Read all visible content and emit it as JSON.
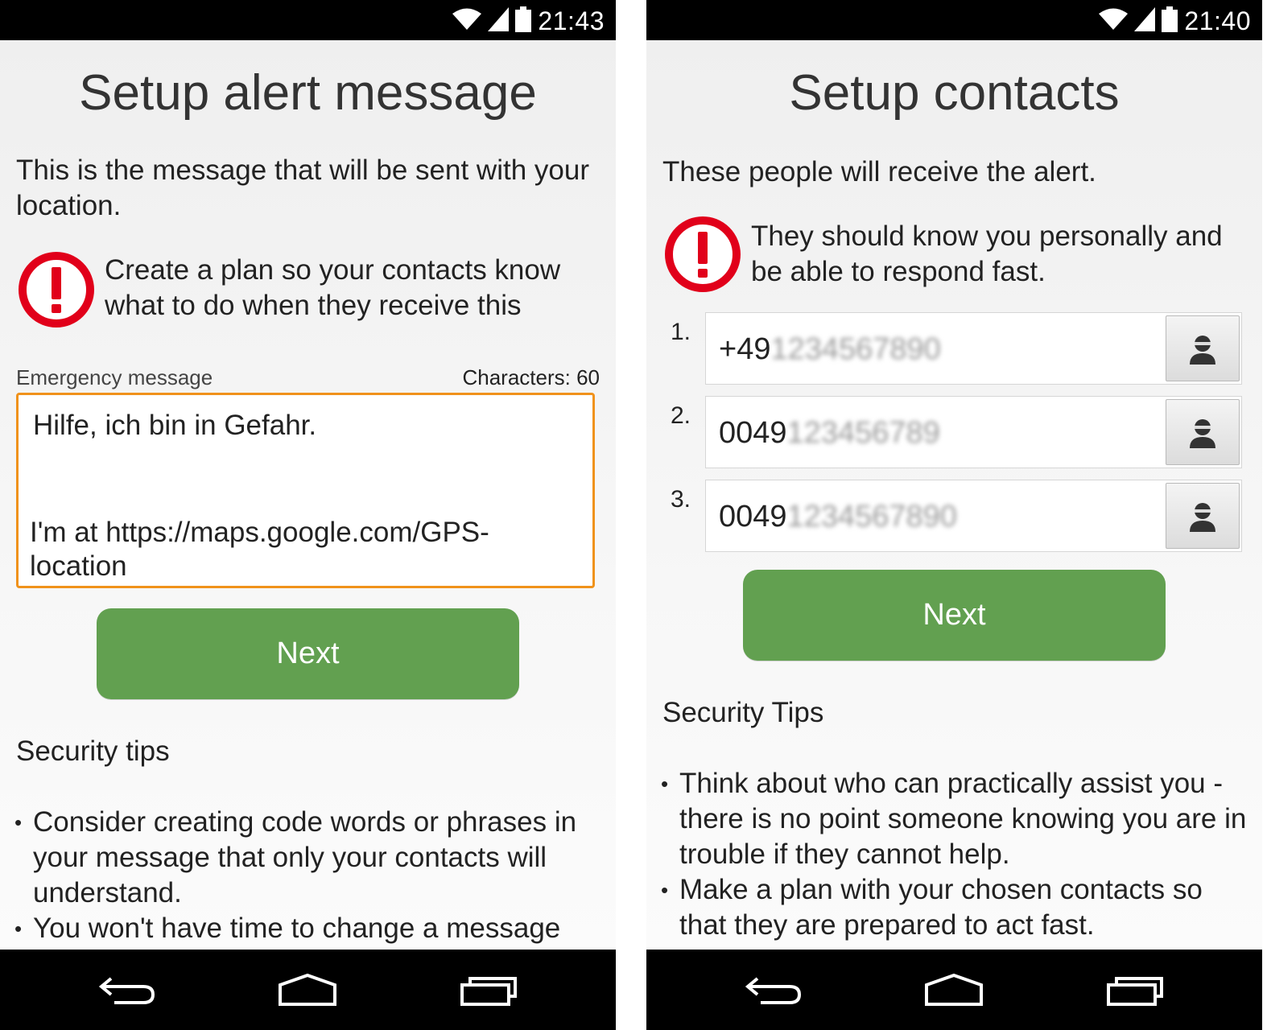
{
  "left": {
    "status_time": "21:43",
    "title": "Setup alert message",
    "intro": "This is the message that will be sent with your location.",
    "alert_note": "Create a plan so your contacts know what to do when they receive this",
    "field_label": "Emergency message",
    "char_count": "Characters: 60",
    "message_line1": "Hilfe, ich bin in Gefahr.",
    "message_line2": "I'm at https://maps.google.com/GPS-location",
    "next_label": "Next",
    "tips_heading": "Security tips",
    "tips": [
      "Consider creating code words or phrases in your message that only your contacts will understand.",
      "You won't have time to change a message"
    ]
  },
  "right": {
    "status_time": "21:40",
    "title": "Setup contacts",
    "intro": "These people will receive the alert.",
    "alert_note": "They should know you personally and be able to respond fast.",
    "contacts": [
      {
        "index": "1.",
        "prefix": "+49",
        "hidden": "1234567890"
      },
      {
        "index": "2.",
        "prefix": "0049",
        "hidden": "123456789"
      },
      {
        "index": "3.",
        "prefix": "0049",
        "hidden": "1234567890"
      }
    ],
    "next_label": "Next",
    "tips_heading": "Security Tips",
    "tips": [
      "Think about who can practically assist you - there is no point someone knowing you are in trouble if they cannot help.",
      "Make a plan with your chosen contacts so that they are prepared to act fast."
    ]
  },
  "icons": {
    "wifi": "wifi-icon",
    "signal": "signal-icon",
    "battery": "battery-icon",
    "alert": "exclamation-alert-icon",
    "contact": "person-icon",
    "back": "back-icon",
    "home": "home-icon",
    "recents": "recent-apps-icon"
  },
  "colors": {
    "accent_green": "#62a050",
    "alert_red": "#e1001a",
    "focus_orange": "#f0921b"
  }
}
